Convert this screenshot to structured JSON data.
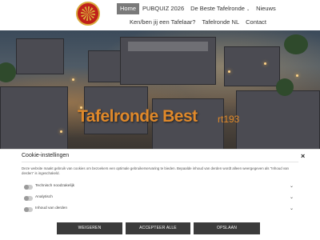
{
  "header": {
    "nav_row1": [
      "Home",
      "PUBQUIZ 2026",
      "De Beste Tafelronde",
      "Nieuws"
    ],
    "nav_row2": [
      "Ken/ben jij een Tafelaar?",
      "Tafelronde NL",
      "Contact"
    ],
    "active_item": "Home"
  },
  "hero": {
    "title": "Tafelronde Best",
    "subtitle": "rt193"
  },
  "cookie": {
    "title": "Cookie-instellingen",
    "close": "×",
    "text": "Deze website maakt gebruik van cookies om bezoekers een optimale gebruikerservaring te bieden. Bepaalde inhoud van derden wordt alleen weergegeven als \"Inhoud van derden\" is ingeschakeld.",
    "options": [
      {
        "label": "Technisch noodzakelijk",
        "enabled": true
      },
      {
        "label": "Analytisch",
        "enabled": false
      },
      {
        "label": "Inhoud van derden",
        "enabled": false
      }
    ],
    "buttons": {
      "refuse": "WEIGEREN",
      "accept_all": "ACCEPTEER ALLE",
      "save": "OPSLAAN"
    }
  },
  "colors": {
    "title_orange": "#e0892a",
    "button_dark": "#3b3b3b",
    "active_nav": "#7a7a7a"
  }
}
